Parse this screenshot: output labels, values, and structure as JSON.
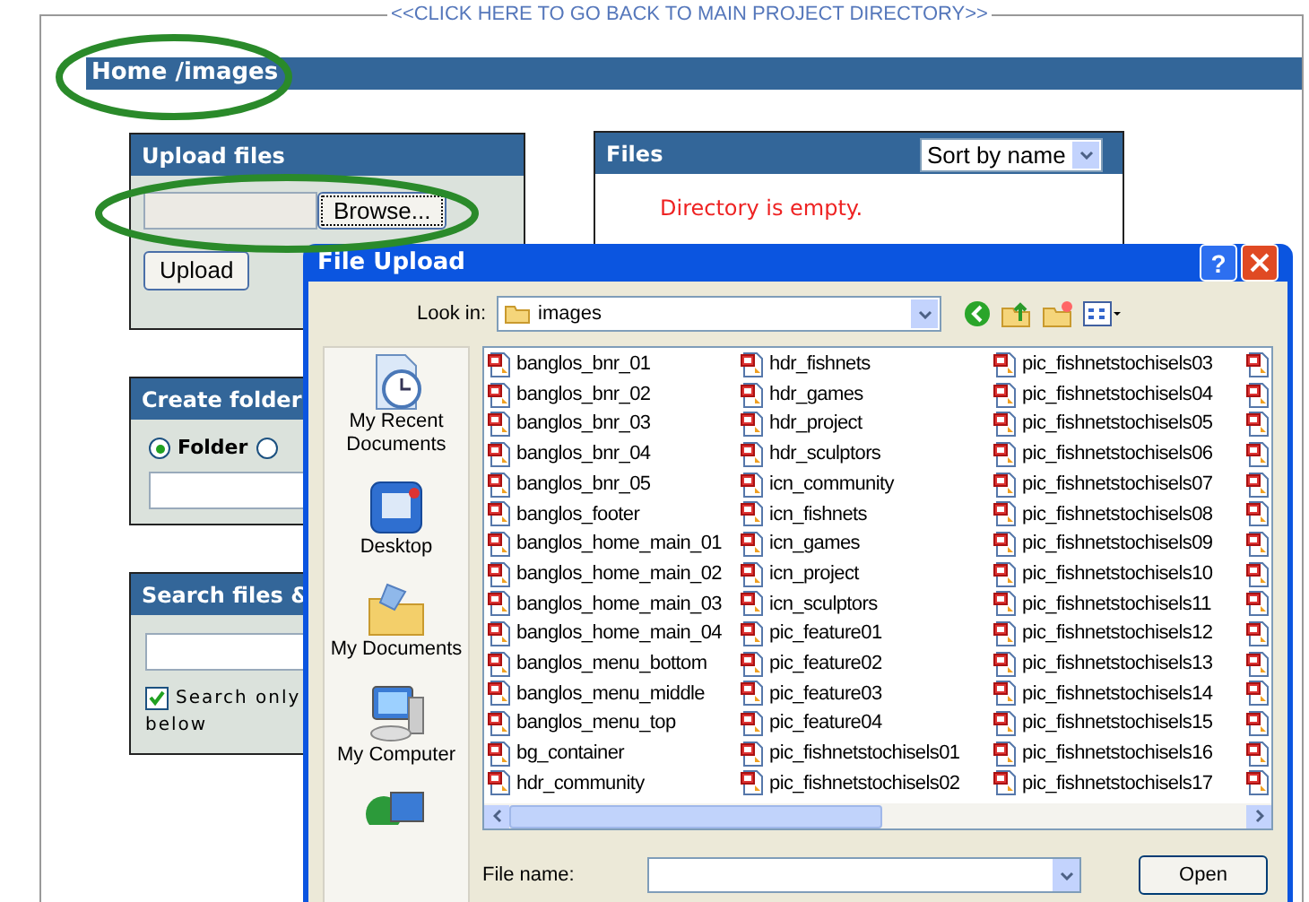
{
  "back_link": "<<CLICK HERE TO GO BACK TO MAIN PROJECT DIRECTORY>>",
  "breadcrumb": "Home /images",
  "upload_panel": {
    "title": "Upload files",
    "browse_button": "Browse...",
    "upload_button": "Upload"
  },
  "files_panel": {
    "title": "Files",
    "sort_select": "Sort by name",
    "message": "Directory is empty."
  },
  "create_folder_panel": {
    "title": "Create folder",
    "radios": [
      {
        "label": "Folder",
        "selected": true
      },
      {
        "selected": false
      }
    ]
  },
  "search_panel": {
    "title": "Search files &",
    "checkbox": {
      "label": "Search only",
      "checked": true
    },
    "label_continued": "below"
  },
  "dialog": {
    "title": "File Upload",
    "help_button": "?",
    "look_in_label": "Look in:",
    "look_in_value": "images",
    "places": [
      {
        "label": "My Recent Documents",
        "kind": "recent"
      },
      {
        "label": "Desktop",
        "kind": "desktop"
      },
      {
        "label": "My Documents",
        "kind": "documents"
      },
      {
        "label": "My Computer",
        "kind": "computer"
      },
      {
        "kind": "network"
      }
    ],
    "file_columns": [
      [
        "banglos_bnr_01",
        "banglos_bnr_02",
        "banglos_bnr_03",
        "banglos_bnr_04",
        "banglos_bnr_05",
        "banglos_footer",
        "banglos_home_main_01",
        "banglos_home_main_02",
        "banglos_home_main_03",
        "banglos_home_main_04",
        "banglos_menu_bottom",
        "banglos_menu_middle",
        "banglos_menu_top",
        "bg_container",
        "hdr_community"
      ],
      [
        "hdr_fishnets",
        "hdr_games",
        "hdr_project",
        "hdr_sculptors",
        "icn_community",
        "icn_fishnets",
        "icn_games",
        "icn_project",
        "icn_sculptors",
        "pic_feature01",
        "pic_feature02",
        "pic_feature03",
        "pic_feature04",
        "pic_fishnetstochisels01",
        "pic_fishnetstochisels02"
      ],
      [
        "pic_fishnetstochisels03",
        "pic_fishnetstochisels04",
        "pic_fishnetstochisels05",
        "pic_fishnetstochisels06",
        "pic_fishnetstochisels07",
        "pic_fishnetstochisels08",
        "pic_fishnetstochisels09",
        "pic_fishnetstochisels10",
        "pic_fishnetstochisels11",
        "pic_fishnetstochisels12",
        "pic_fishnetstochisels13",
        "pic_fishnetstochisels14",
        "pic_fishnetstochisels15",
        "pic_fishnetstochisels16",
        "pic_fishnetstochisels17"
      ]
    ],
    "file_name_label": "File name:",
    "open_button": "Open"
  }
}
